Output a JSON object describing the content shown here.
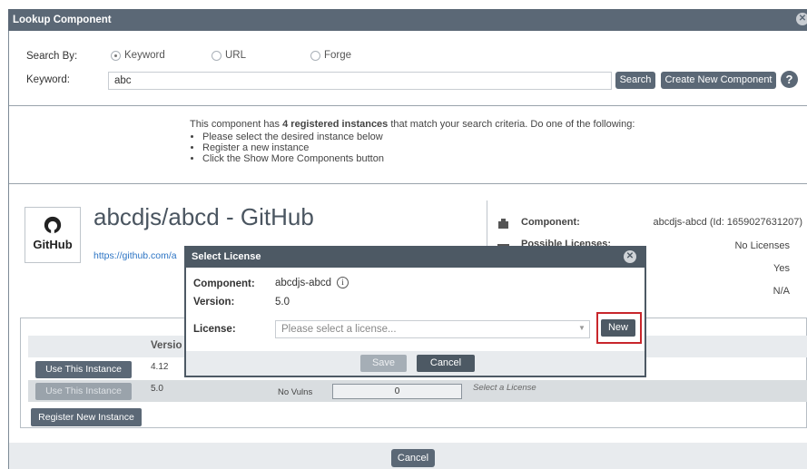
{
  "window": {
    "title": "Lookup Component",
    "close_icon": "close-icon"
  },
  "search": {
    "by_label": "Search By:",
    "options": [
      {
        "label": "Keyword",
        "selected": true
      },
      {
        "label": "URL",
        "selected": false
      },
      {
        "label": "Forge",
        "selected": false
      }
    ],
    "keyword_label": "Keyword:",
    "keyword_value": "abc",
    "search_button": "Search",
    "create_button": "Create New Component",
    "help": "?"
  },
  "message": {
    "prefix": "This component has ",
    "bold": "4 registered instances",
    "suffix": " that match your search criteria. Do one of the following:",
    "bullets": [
      "Please select the desired instance below",
      "Register a new instance",
      "Click the Show More Components button"
    ]
  },
  "component": {
    "logo_text": "GitHub",
    "name": "abcdjs/abcd - GitHub",
    "url": "https://github.com/a",
    "info": {
      "component_label": "Component:",
      "component_value": "abcdjs-abcd (Id: 1659027631207)",
      "licenses_label": "Possible Licenses:",
      "licenses_value": "No Licenses",
      "row3_value": "Yes",
      "row4_value": "N/A"
    }
  },
  "instances": {
    "version_header": "Versio",
    "rows": [
      {
        "button": "Use This Instance",
        "version": "4.12"
      },
      {
        "button": "Use This Instance",
        "version": "5.0",
        "vulns_label": "No Vulns",
        "vulns_count": "0",
        "license_hint": "Select a License"
      }
    ],
    "register_button": "Register New Instance"
  },
  "footer": {
    "cancel": "Cancel"
  },
  "modal": {
    "title": "Select License",
    "component_label": "Component:",
    "component_value": "abcdjs-abcd",
    "info_icon": "i",
    "version_label": "Version:",
    "version_value": "5.0",
    "license_label": "License:",
    "license_placeholder": "Please select a license...",
    "new_button": "New",
    "save_button": "Save",
    "cancel_button": "Cancel"
  },
  "colors": {
    "header": "#5b6876",
    "modal_header": "#4d5964",
    "highlight": "#c8262c",
    "link": "#2c74c4"
  }
}
